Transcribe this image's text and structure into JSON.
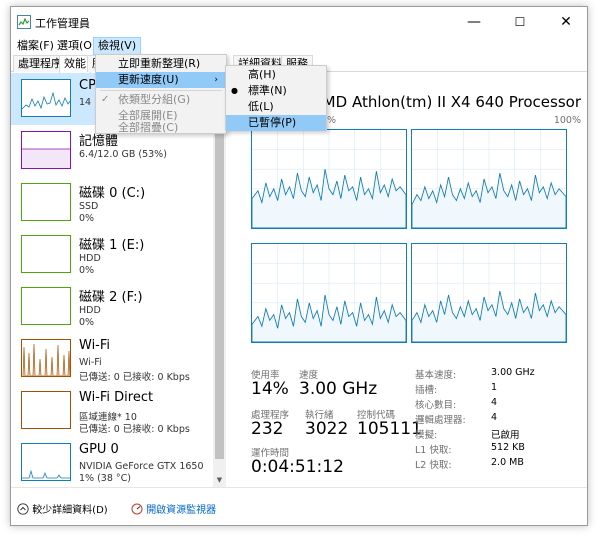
{
  "window": {
    "title": "工作管理員",
    "controls": {
      "minimize": "—",
      "maximize": "☐",
      "close": "✕"
    }
  },
  "menubar": {
    "items": [
      {
        "label": "檔案(F)"
      },
      {
        "label": "選項(O)"
      },
      {
        "label": "檢視(V)"
      }
    ]
  },
  "tabs": [
    {
      "label": "處理程序"
    },
    {
      "label": "效能"
    },
    {
      "label": "服"
    },
    {
      "label": "詳細資料"
    },
    {
      "label": "服務"
    }
  ],
  "sidebar": [
    {
      "title": "CP",
      "lines": [
        "14"
      ],
      "color": "#117dbb"
    },
    {
      "title": "記憶體",
      "lines": [
        "6.4/12.0 GB (53%)"
      ],
      "color": "#8b12ae"
    },
    {
      "title": "磁碟 0 (C:)",
      "lines": [
        "SSD",
        "0%"
      ],
      "color": "#4da60c"
    },
    {
      "title": "磁碟 1 (E:)",
      "lines": [
        "HDD",
        "0%"
      ],
      "color": "#4da60c"
    },
    {
      "title": "磁碟 2 (F:)",
      "lines": [
        "HDD",
        "0%"
      ],
      "color": "#4da60c"
    },
    {
      "title": "Wi-Fi",
      "lines": [
        "Wi-Fi",
        "已傳送: 0 已接收: 0 Kbps"
      ],
      "color": "#a74f01"
    },
    {
      "title": "Wi-Fi Direct",
      "lines": [
        "區域連線* 10",
        "已傳送: 0 已接收: 0 Kbps"
      ],
      "color": "#a74f01"
    },
    {
      "title": "GPU 0",
      "lines": [
        "NVIDIA GeForce GTX 1650",
        "1% (38 °C)"
      ],
      "color": "#117dbb"
    }
  ],
  "view_menu": {
    "items": [
      {
        "label": "立即重新整理(R)"
      },
      {
        "label": "更新速度(U)",
        "arrow": "›"
      },
      {
        "label": "依類型分組(G)",
        "check": "✓"
      },
      {
        "label": "全部展開(E)"
      },
      {
        "label": "全部摺疊(C)"
      }
    ]
  },
  "speed_menu": {
    "items": [
      {
        "label": "高(H)"
      },
      {
        "label": "標準(N)",
        "bullet": "●"
      },
      {
        "label": "低(L)"
      },
      {
        "label": "已暫停(P)"
      }
    ]
  },
  "main": {
    "processor": "AMD Athlon(tm) II X4 640 Processor",
    "pct_left": "%",
    "pct_right": "100%",
    "stats": {
      "usage_label": "使用率",
      "usage_value": "14%",
      "speed_label": "速度",
      "speed_value": "3.00 GHz",
      "procs_label": "處理程序",
      "procs_value": "232",
      "threads_label": "執行緒",
      "threads_value": "3022",
      "handles_label": "控制代碼",
      "handles_value": "105111",
      "uptime_label": "運作時間",
      "uptime_value": "0:04:51:12"
    },
    "specs": [
      {
        "label": "基本速度:",
        "value": "3.00 GHz"
      },
      {
        "label": "插槽:",
        "value": "1"
      },
      {
        "label": "核心數目:",
        "value": "4"
      },
      {
        "label": "邏輯處理器:",
        "value": "4"
      },
      {
        "label": "模擬:",
        "value": "已啟用"
      },
      {
        "label": "L1 快取:",
        "value": "512 KB"
      },
      {
        "label": "L2 快取:",
        "value": "2.0 MB"
      }
    ]
  },
  "footer": {
    "fewer_details": "較少詳細資料(D)",
    "resource_monitor": "開啟資源監視器"
  },
  "colors": {
    "accent": "#117dbb",
    "selection": "#cce8ff",
    "menu_hover": "#91c9f7"
  }
}
